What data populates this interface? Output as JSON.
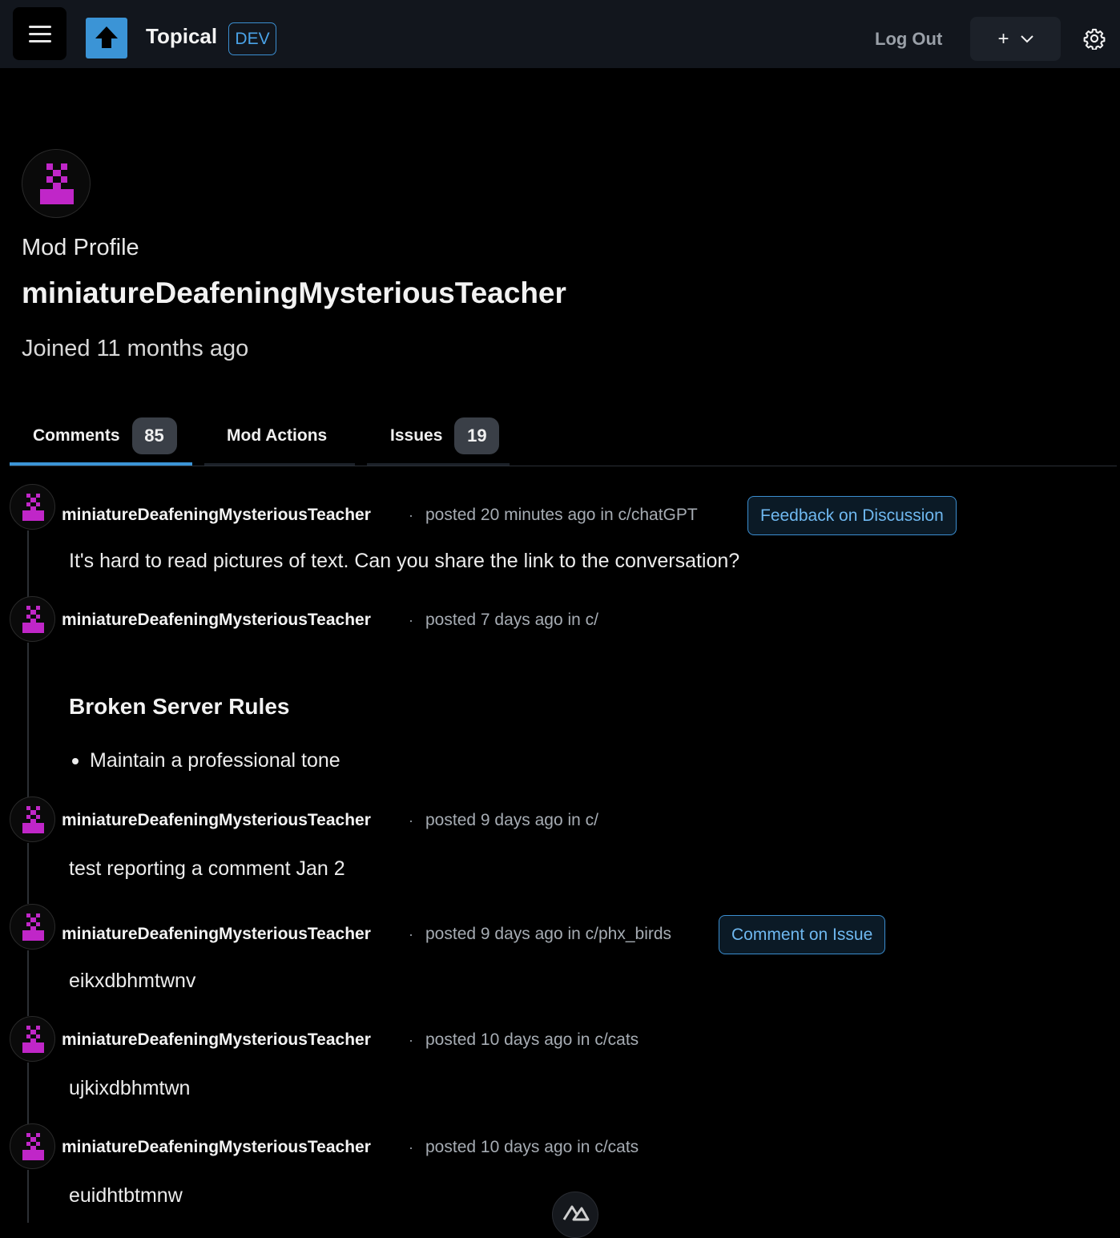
{
  "header": {
    "app_name": "Topical",
    "env_badge": "DEV",
    "logout_label": "Log Out",
    "create_label": "+",
    "icons": [
      "menu-icon",
      "logo-upload-icon",
      "chevron-down-icon",
      "gear-icon"
    ],
    "colors": {
      "accent": "#3b94d6",
      "topbar": "#12161d",
      "avatar": "#c026c8"
    }
  },
  "profile": {
    "heading": "Mod Profile",
    "username": "miniatureDeafeningMysteriousTeacher",
    "joined": "Joined 11 months ago"
  },
  "tabs": [
    {
      "label": "Comments",
      "count": "85",
      "active": true
    },
    {
      "label": "Mod Actions",
      "count": null,
      "active": false
    },
    {
      "label": "Issues",
      "count": "19",
      "active": false
    }
  ],
  "comments": [
    {
      "author": "miniatureDeafeningMysteriousTeacher",
      "meta": "posted 20 minutes ago in c/chatGPT",
      "badge": "Feedback on Discussion",
      "body": "It's hard to read pictures of text. Can you share the link to the conversation?"
    },
    {
      "author": "miniatureDeafeningMysteriousTeacher",
      "meta": "posted 7 days ago in c/",
      "badge": null,
      "heading": "Broken Server Rules",
      "list": [
        "Maintain a professional tone"
      ]
    },
    {
      "author": "miniatureDeafeningMysteriousTeacher",
      "meta": "posted 9 days ago in c/",
      "badge": null,
      "body": "test reporting a comment Jan 2"
    },
    {
      "author": "miniatureDeafeningMysteriousTeacher",
      "meta": "posted 9 days ago in c/phx_birds",
      "badge": "Comment on Issue",
      "body": "eikxdbhmtwnv"
    },
    {
      "author": "miniatureDeafeningMysteriousTeacher",
      "meta": "posted 10 days ago in c/cats",
      "badge": null,
      "body": "ujkixdbhmtwn"
    },
    {
      "author": "miniatureDeafeningMysteriousTeacher",
      "meta": "posted 10 days ago in c/cats",
      "badge": null,
      "body": "euidhtbtmnw"
    }
  ],
  "separator": "·"
}
